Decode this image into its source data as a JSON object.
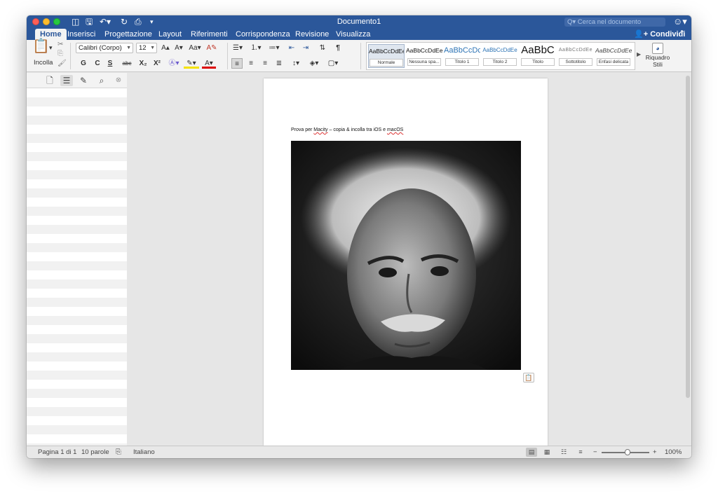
{
  "window": {
    "title": "Documento1",
    "search_placeholder": "Q▾ Cerca nel documento",
    "qa_icons": [
      "sidebar-toggle-icon",
      "save-icon",
      "undo-icon",
      "redo-icon",
      "print-icon",
      "customize-icon"
    ]
  },
  "menu": {
    "tabs": [
      "Home",
      "Inserisci",
      "Progettazione",
      "Layout",
      "Riferimenti",
      "Corrispondenza",
      "Revisione",
      "Visualizza"
    ],
    "active_tab": "Home",
    "share_label": "Condividi"
  },
  "ribbon": {
    "paste_label": "Incolla",
    "font_name": "Calibri (Corpo)",
    "font_size": "12",
    "bold": "G",
    "italic": "C",
    "underline": "S",
    "strike": "abc",
    "sub": "X₂",
    "sup": "X²",
    "styles": [
      {
        "preview": "AaBbCcDdEe",
        "name": "Normale"
      },
      {
        "preview": "AaBbCcDdEe",
        "name": "Nessuna spa..."
      },
      {
        "preview": "AaBbCcDc",
        "name": "Titolo 1"
      },
      {
        "preview": "AaBbCcDdEe",
        "name": "Titolo 2"
      },
      {
        "preview": "AaBbC",
        "name": "Titolo"
      },
      {
        "preview": "AaBbCcDdEe",
        "name": "Sottotitolo"
      },
      {
        "preview": "AaBbCcDdEe",
        "name": "Enfasi delicata"
      }
    ],
    "styles_pane_label_1": "Riquadro",
    "styles_pane_label_2": "Stili"
  },
  "document": {
    "line_prefix": "Prova per ",
    "line_word1": "Macity",
    "line_mid": " – copia & incolla tra iOS e ",
    "line_word2": "macOS"
  },
  "status": {
    "page": "Pagina 1 di 1",
    "words": "10 parole",
    "language": "Italiano",
    "zoom": "100%",
    "zoom_fraction": 0.5
  },
  "colors": {
    "brand": "#2b579a",
    "ribbon_bg": "#f3f3f3",
    "canvas_bg": "#e6e6e6"
  }
}
